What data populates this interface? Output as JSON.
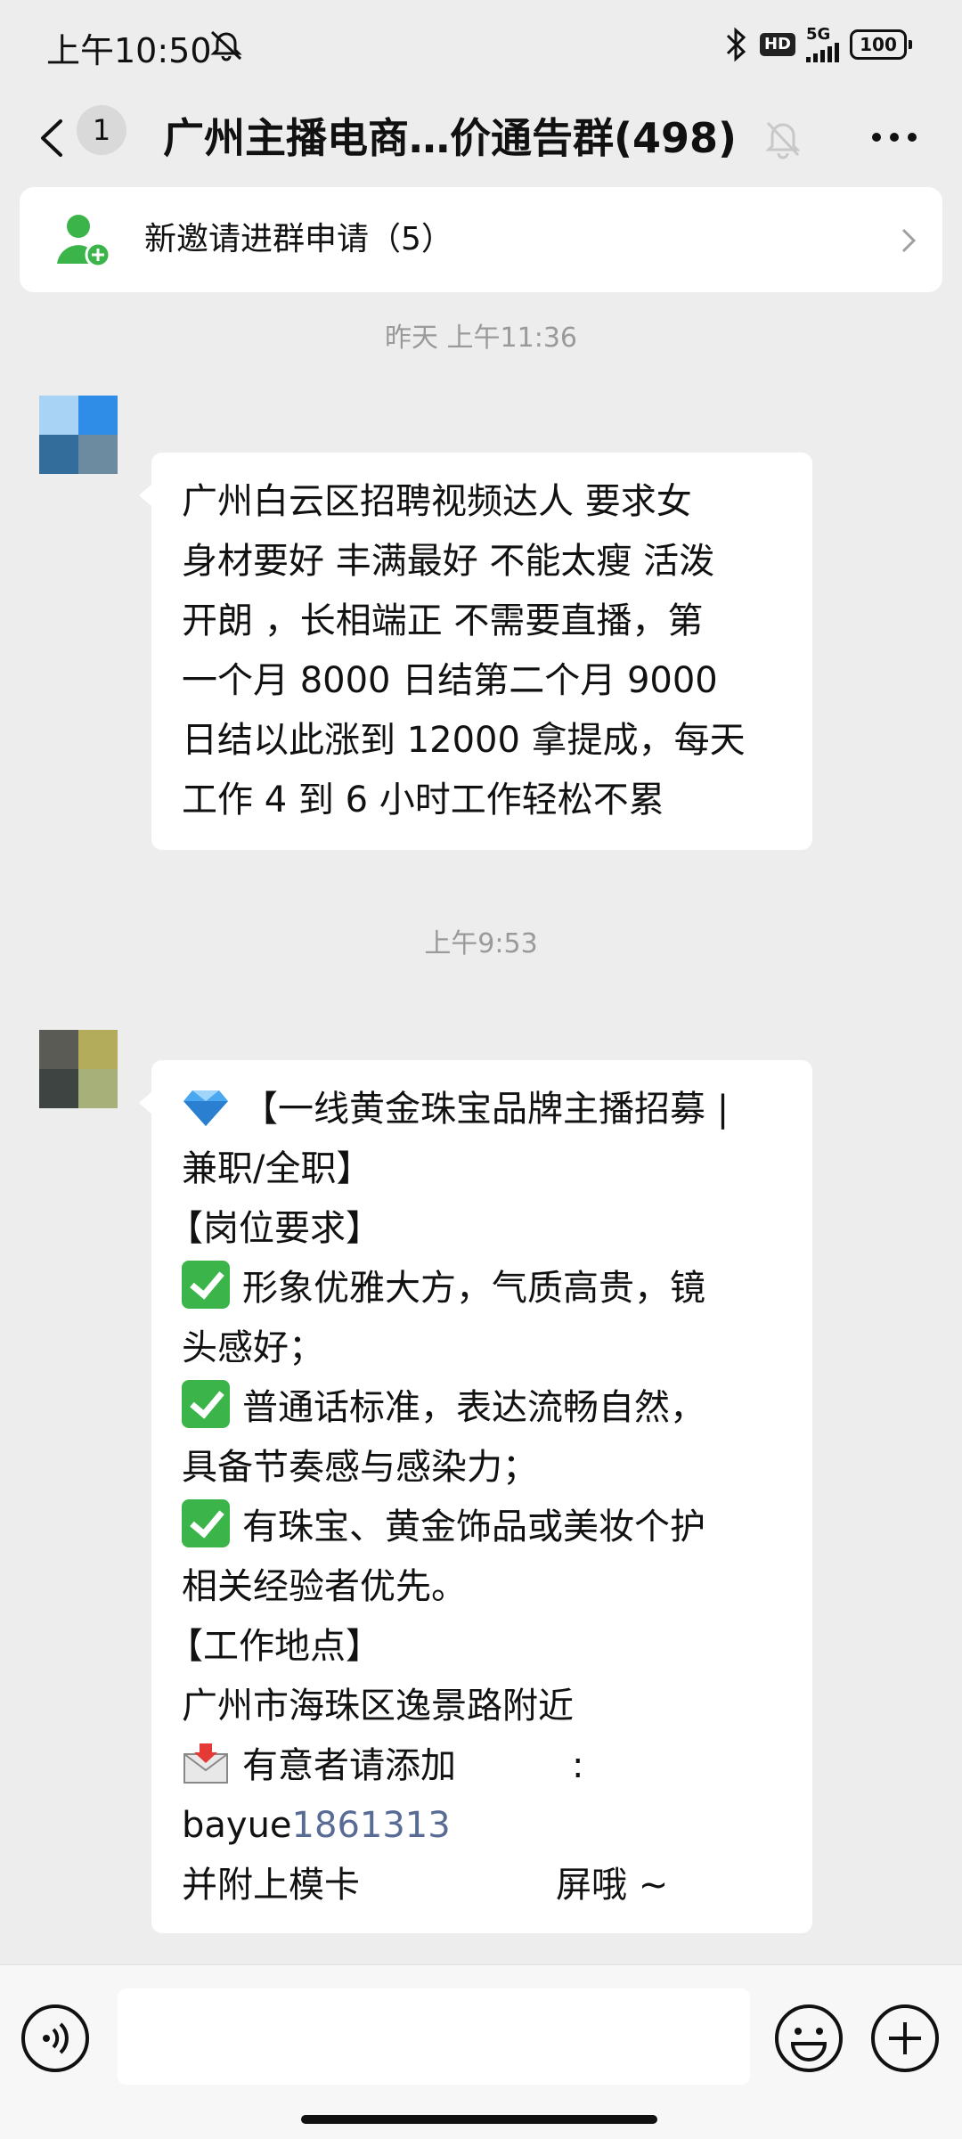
{
  "status_bar": {
    "time": "上午10:50",
    "hd": "HD",
    "network": "5G",
    "battery": "100",
    "icons": [
      "mute-icon",
      "bluetooth-icon",
      "signal-icon",
      "battery-icon"
    ]
  },
  "top_bar": {
    "unread_count": "1",
    "title": "广州主播电商…价通告群(498)",
    "icons": [
      "back-icon",
      "bell-off-icon",
      "more-icon"
    ]
  },
  "invite_bar": {
    "label": "新邀请进群申请（5）",
    "icons": [
      "add-member-icon",
      "chevron-right-icon"
    ]
  },
  "messages": [
    {
      "timestamp": "昨天 上午11:36",
      "lines": [
        "广州白云区招聘视频达人 要求女",
        "身材要好 丰满最好 不能太瘦 活泼",
        "开朗 ，长相端正 不需要直播，第",
        "一个月 8000 日结第二个月 9000",
        "日结以此涨到 12000 拿提成，每天",
        "工作 4 到 6 小时工作轻松不累"
      ]
    },
    {
      "timestamp": "上午9:53",
      "title_line_1": "【一线黄金珠宝品牌主播招募 |",
      "title_line_2": "兼职/全职】",
      "requirements_header": "【岗位要求】",
      "req_1_a": "形象优雅大方，气质高贵，镜",
      "req_1_b": "头感好；",
      "req_2_a": "普通话标准，表达流畅自然，",
      "req_2_b": "具备节奏感与感染力；",
      "req_3_a": "有珠宝、黄金饰品或美妆个护",
      "req_3_b": "相关经验者优先。",
      "location_header": "【工作地点】",
      "location": "广州市海珠区逸景路附近",
      "contact_prefix": "有意者请添加",
      "contact_suffix": ":",
      "wechat_prefix": "bayue",
      "wechat_number": "1861313",
      "closing_prefix": "并附上模卡",
      "closing_suffix": "屏哦 ~"
    }
  ],
  "input_bar": {
    "placeholder": "",
    "icons": [
      "voice-icon",
      "emoji-icon",
      "plus-icon"
    ]
  },
  "colors": {
    "background": "#ededed",
    "bubble": "#ffffff",
    "wechat_green": "#07c160",
    "check_green": "#3bb54a",
    "link_blue": "#576b95"
  }
}
